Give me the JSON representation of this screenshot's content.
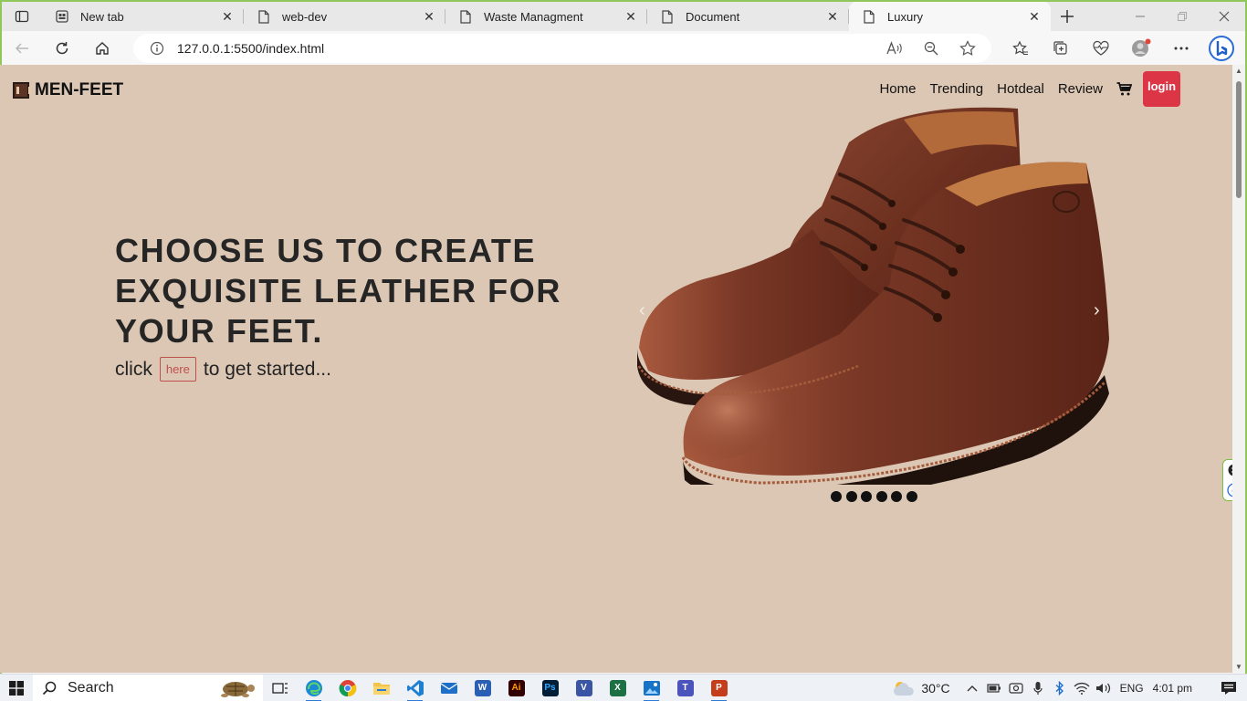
{
  "browser": {
    "tabs": [
      {
        "title": "New tab",
        "icon": "newtab-page-icon",
        "active": false
      },
      {
        "title": "web-dev",
        "icon": "document-icon",
        "active": false
      },
      {
        "title": "Waste Managment",
        "icon": "document-icon",
        "active": false
      },
      {
        "title": "Document",
        "icon": "document-icon",
        "active": false
      },
      {
        "title": "Luxury",
        "icon": "document-icon",
        "active": true
      }
    ],
    "address": "127.0.0.1:5500/index.html",
    "accent": "#8fc75a"
  },
  "page": {
    "brand": "MEN-FEET",
    "nav": [
      "Home",
      "Trending",
      "Hotdeal",
      "Review"
    ],
    "login_label": "login",
    "hero_heading": "CHOOSE US TO CREATE EXQUISITE LEATHER FOR YOUR FEET.",
    "cta_before": "click",
    "cta_button": "here",
    "cta_after": "to get started...",
    "carousel_slide_count": 6,
    "background": "#dcc7b4",
    "login_color": "#dc3545"
  },
  "taskbar": {
    "search_label": "Search",
    "temperature": "30°C",
    "language": "ENG",
    "time": "4:01 pm"
  }
}
